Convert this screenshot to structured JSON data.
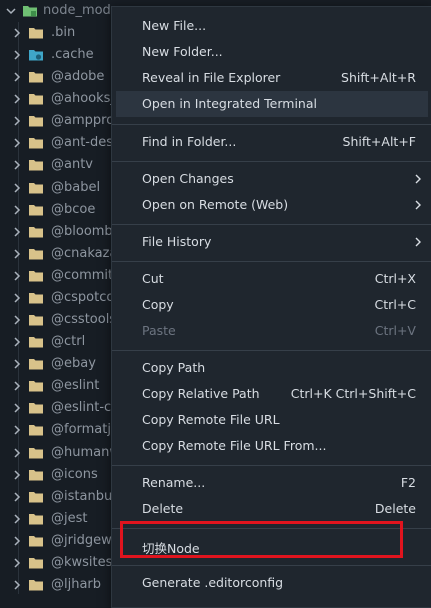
{
  "explorer": {
    "root": "node_modul",
    "items": [
      ".bin",
      ".cache",
      "@adobe",
      "@ahooksjs",
      "@ampproj",
      "@ant-desi",
      "@antv",
      "@babel",
      "@bcoe",
      "@bloombe",
      "@cnakazav",
      "@commitl",
      "@cspotcod",
      "@csstools",
      "@ctrl",
      "@ebay",
      "@eslint",
      "@eslint-co",
      "@formatjs",
      "@humanw",
      "@icons",
      "@istanbulj",
      "@jest",
      "@jridgewe",
      "@kwsites",
      "@ljharb"
    ]
  },
  "menu": {
    "new_file": "New File...",
    "new_folder": "New Folder...",
    "reveal": "Reveal in File Explorer",
    "reveal_key": "Shift+Alt+R",
    "open_terminal": "Open in Integrated Terminal",
    "find_in_folder": "Find in Folder...",
    "find_in_folder_key": "Shift+Alt+F",
    "open_changes": "Open Changes",
    "open_remote": "Open on Remote (Web)",
    "file_history": "File History",
    "cut": "Cut",
    "cut_key": "Ctrl+X",
    "copy": "Copy",
    "copy_key": "Ctrl+C",
    "paste": "Paste",
    "paste_key": "Ctrl+V",
    "copy_path": "Copy Path",
    "copy_relative_path": "Copy Relative Path",
    "copy_relative_path_key": "Ctrl+K Ctrl+Shift+C",
    "copy_remote_url": "Copy Remote File URL",
    "copy_remote_url_from": "Copy Remote File URL From...",
    "rename": "Rename...",
    "rename_key": "F2",
    "delete": "Delete",
    "delete_key": "Delete",
    "switch_node": "切换Node",
    "generate_editorconfig": "Generate .editorconfig"
  },
  "colors": {
    "background": "#171d24",
    "menu_background": "#1f262e",
    "highlight_box": "#e0141e",
    "folder": "#d8c28a",
    "folder_root": "#6fbf73"
  }
}
